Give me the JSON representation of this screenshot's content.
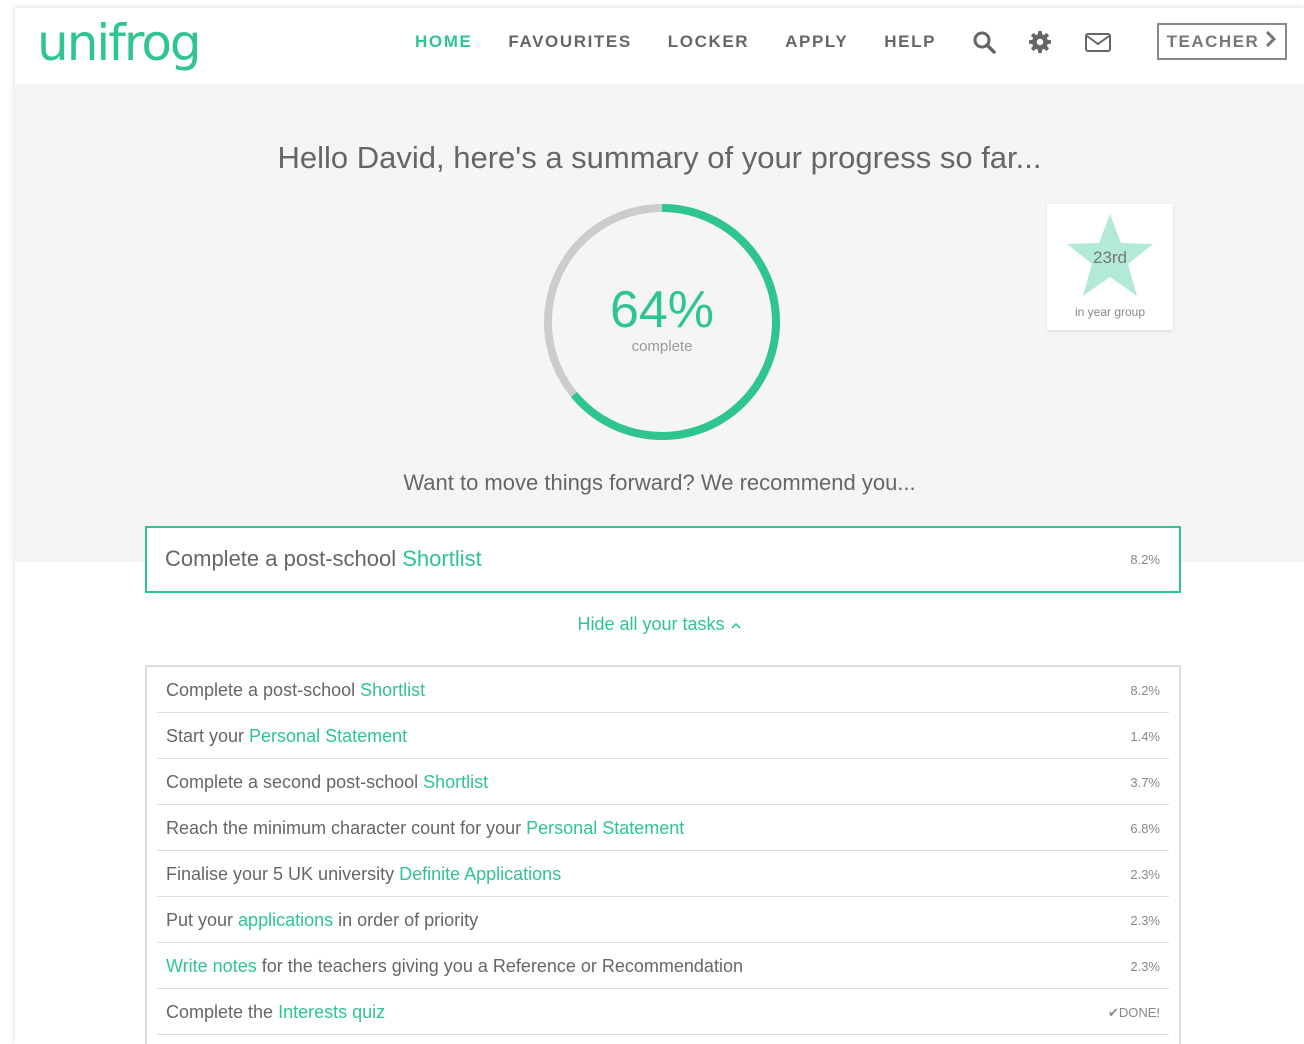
{
  "brand": {
    "logo_text": "unifrog",
    "accent": "#2fc58f"
  },
  "nav": {
    "items": [
      {
        "label": "HOME",
        "active": true
      },
      {
        "label": "FAVOURITES",
        "active": false
      },
      {
        "label": "LOCKER",
        "active": false
      },
      {
        "label": "APPLY",
        "active": false
      },
      {
        "label": "HELP",
        "active": false
      }
    ],
    "icons": [
      "search-icon",
      "gear-icon",
      "mail-icon"
    ],
    "teacher_label": "TEACHER",
    "teacher_icon": "chevron-right-icon"
  },
  "hero": {
    "greeting": "Hello David, here's a summary of your progress so far...",
    "progress_value": 64,
    "progress_text": "64%",
    "progress_sub": "complete",
    "rank": "23rd",
    "rank_sub": "in year group",
    "recommend": "Want to move things forward? We recommend you..."
  },
  "recommendation": {
    "prefix": "Complete a post-school ",
    "link": "Shortlist",
    "suffix": "",
    "pct": "8.2%"
  },
  "toggle_label": "Hide all your tasks",
  "tasks": [
    {
      "prefix": "Complete a post-school ",
      "link": "Shortlist",
      "suffix": "",
      "pct": "8.2%"
    },
    {
      "prefix": "Start your ",
      "link": "Personal Statement",
      "suffix": "",
      "pct": "1.4%"
    },
    {
      "prefix": "Complete a second post-school ",
      "link": "Shortlist",
      "suffix": "",
      "pct": "3.7%"
    },
    {
      "prefix": "Reach the minimum character count for your ",
      "link": "Personal Statement",
      "suffix": "",
      "pct": "6.8%"
    },
    {
      "prefix": "Finalise your 5 UK university ",
      "link": "Definite Applications",
      "suffix": "",
      "pct": "2.3%"
    },
    {
      "prefix": "Put your ",
      "link": "applications",
      "suffix": " in order of priority",
      "pct": "2.3%"
    },
    {
      "prefix": "",
      "link": "Write notes",
      "suffix": " for the teachers giving you a Reference or Recommendation",
      "pct": "2.3%"
    },
    {
      "prefix": "Complete the ",
      "link": "Interests quiz",
      "suffix": "",
      "pct": "✔DONE!"
    }
  ]
}
